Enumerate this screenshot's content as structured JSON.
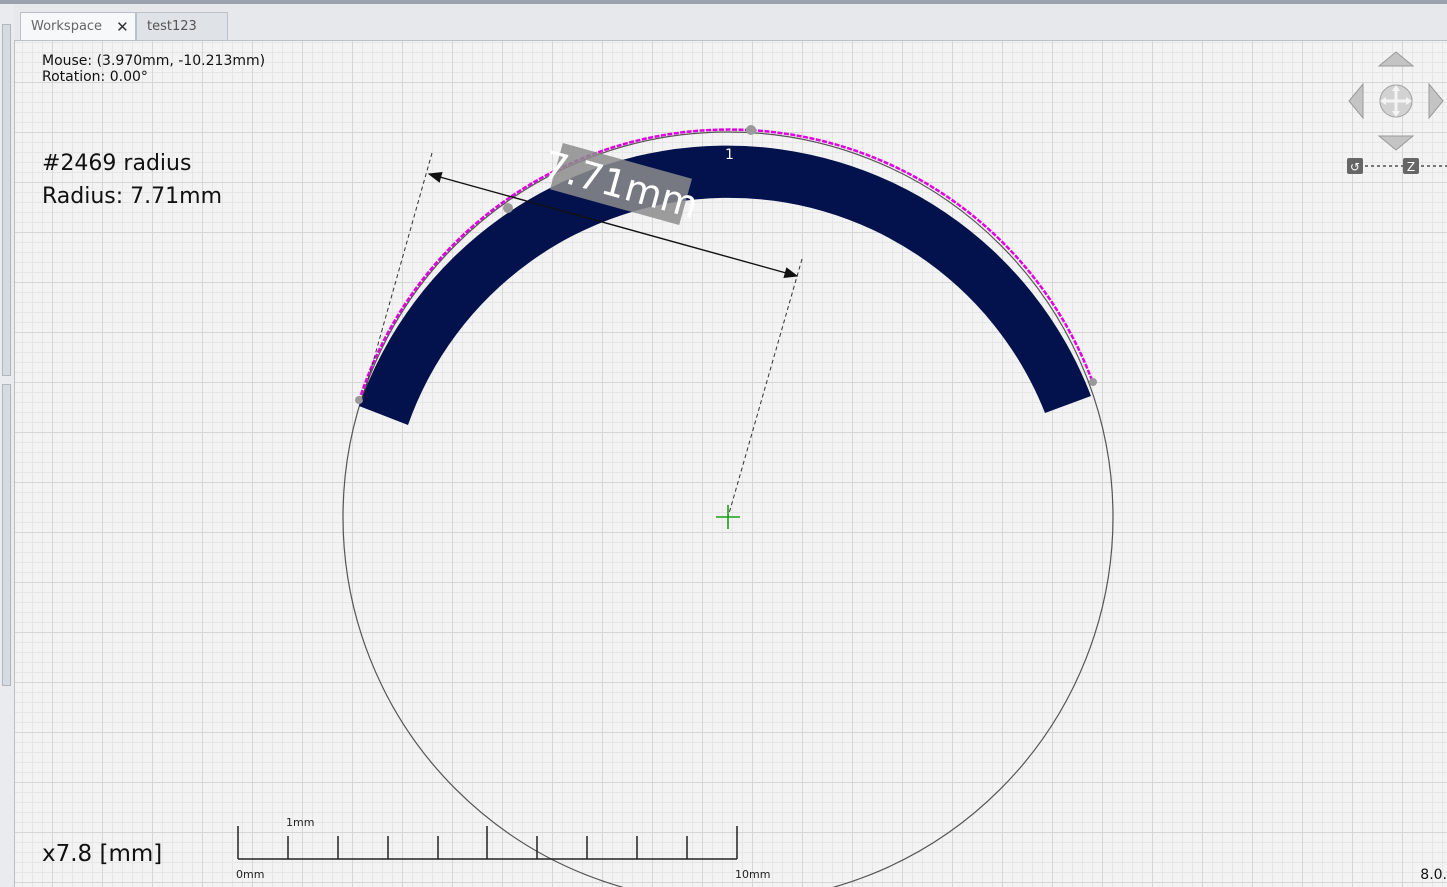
{
  "tabs": [
    {
      "label": "Workspace",
      "active": true,
      "closable": true
    },
    {
      "label": "test123",
      "active": false,
      "closable": false
    }
  ],
  "close_glyph": "✕",
  "status": {
    "mouse": "Mouse: (3.970mm, -10.213mm)",
    "rotation": "Rotation: 0.00°"
  },
  "measurement": {
    "id_line": "#2469 radius",
    "radius_line": "Radius: 7.71mm",
    "dimension_label": "7.71mm",
    "feature_number": "1"
  },
  "scale_bar": {
    "zoom": "x7.8 [mm]",
    "label_1mm": "1mm",
    "label_start": "0mm",
    "label_end": "10mm"
  },
  "version": "8.0.",
  "nav_controls": {
    "rotate_label": "↺",
    "z_label": "Z"
  },
  "colors": {
    "arc_fill": "#03124d",
    "edge_trace": "#e000e0",
    "center_mark": "#1aa01a",
    "circle": "#555555"
  }
}
